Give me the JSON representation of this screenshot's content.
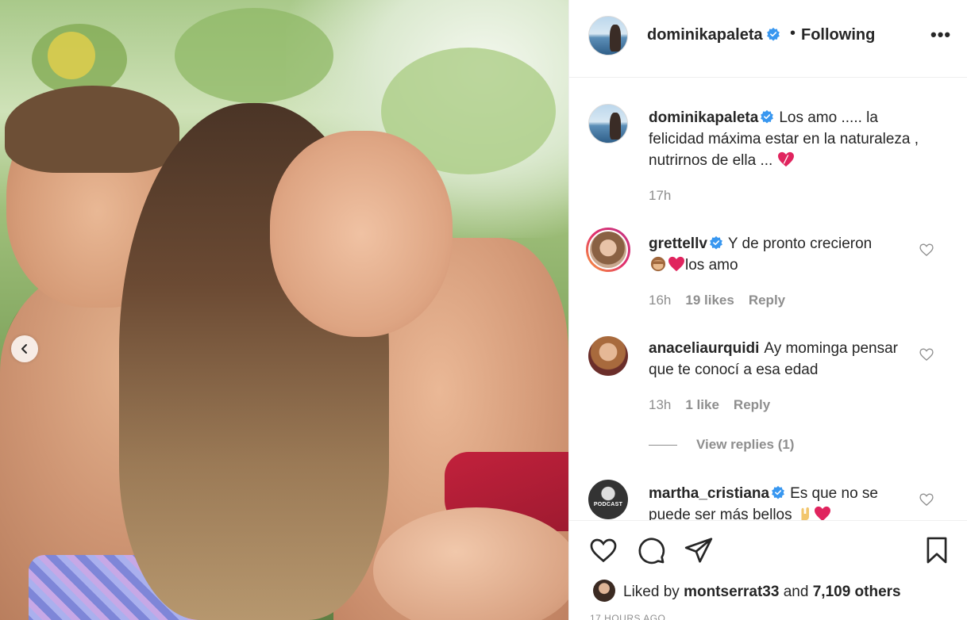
{
  "post": {
    "author": "dominikapaleta",
    "follow_status": "Following",
    "more_label": "•••",
    "separator": "•"
  },
  "caption": {
    "username": "dominikapaleta",
    "text": "Los amo ..... la felicidad máxima estar en la naturaleza , nutrirnos de ella ...",
    "time": "17h"
  },
  "comments": [
    {
      "username": "grettellv",
      "text": "Y de pronto crecieron",
      "text2": "los amo",
      "time": "16h",
      "likes": "19 likes",
      "reply": "Reply"
    },
    {
      "username": "anaceliaurquidi",
      "text": "Ay mominga pensar que te conocí a esa edad",
      "time": "13h",
      "likes": "1 like",
      "reply": "Reply",
      "view_replies": "View replies (1)"
    },
    {
      "username": "martha_cristiana",
      "text": "Es que no se puede ser más bellos",
      "avatar_text": "PODCAST"
    }
  ],
  "likes": {
    "prefix": "Liked by",
    "user": "montserrat33",
    "conj": "and",
    "others": "7,109 others"
  },
  "timestamp": "17 HOURS AGO",
  "colors": {
    "verified": "#3897f0",
    "heart_red": "#ed4956",
    "muted": "#8e8e8e"
  },
  "icons": [
    "chevron-left-icon",
    "verified-badge-icon",
    "heart-icon",
    "comment-icon",
    "share-icon",
    "bookmark-icon"
  ]
}
